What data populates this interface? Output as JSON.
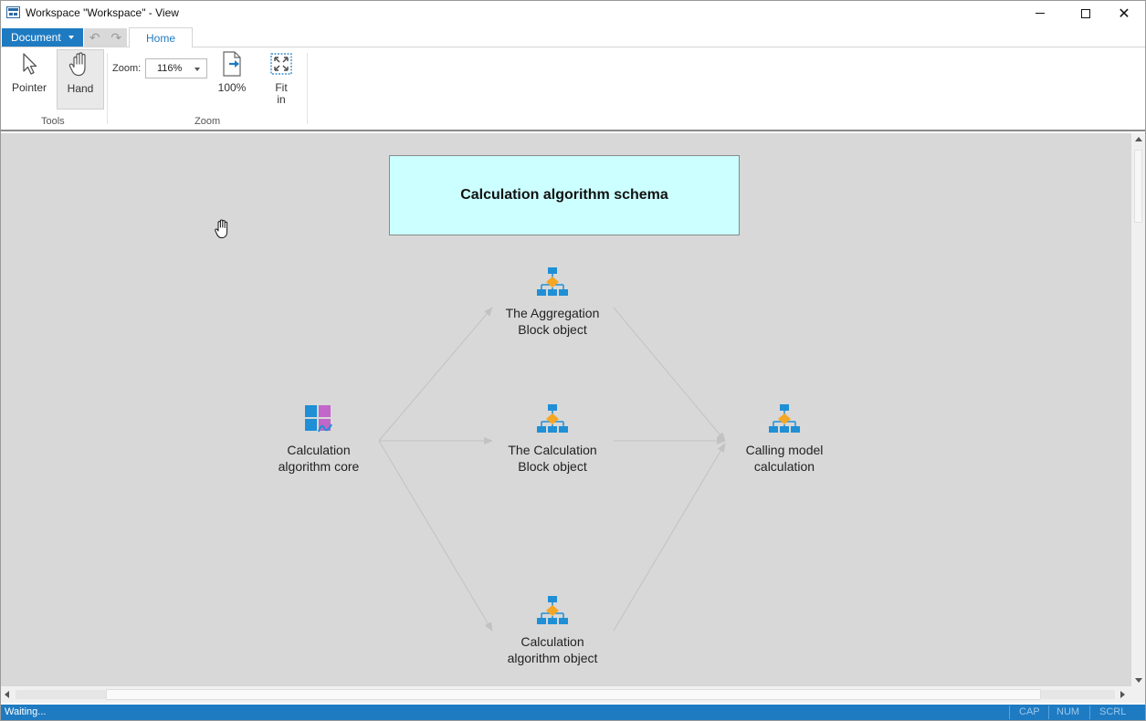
{
  "window": {
    "title": "Workspace \"Workspace\" - View"
  },
  "ribbon": {
    "document_menu": "Document",
    "tabs": [
      {
        "label": "Home"
      }
    ],
    "tools": {
      "pointer": "Pointer",
      "hand": "Hand",
      "group_label": "Tools"
    },
    "zoom": {
      "label": "Zoom:",
      "value": "116%",
      "btn_100": "100%",
      "btn_fit_line1": "Fit",
      "btn_fit_line2": "in",
      "group_label": "Zoom"
    }
  },
  "canvas": {
    "title": "Calculation algorithm schema",
    "nodes": {
      "core": {
        "line1": "Calculation",
        "line2": "algorithm core",
        "icon": "calculation-core-icon"
      },
      "aggregation": {
        "line1": "The Aggregation",
        "line2": "Block object",
        "icon": "block-diagram-icon"
      },
      "calculation_block": {
        "line1": "The Calculation",
        "line2": "Block object",
        "icon": "block-diagram-icon"
      },
      "algorithm_object": {
        "line1": "Calculation",
        "line2": "algorithm object",
        "icon": "block-diagram-icon"
      },
      "calling_model": {
        "line1": "Calling model",
        "line2": "calculation",
        "icon": "block-diagram-icon"
      }
    },
    "colors": {
      "background": "#d8d8d8",
      "title_fill": "#ccffff",
      "edge": "#c2c2c2",
      "icon_blue": "#1f8fd6",
      "icon_orange": "#f5a623"
    }
  },
  "status": {
    "text": "Waiting...",
    "indicators": [
      "CAP",
      "NUM",
      "SCRL"
    ],
    "color": "#1e7bc2"
  }
}
